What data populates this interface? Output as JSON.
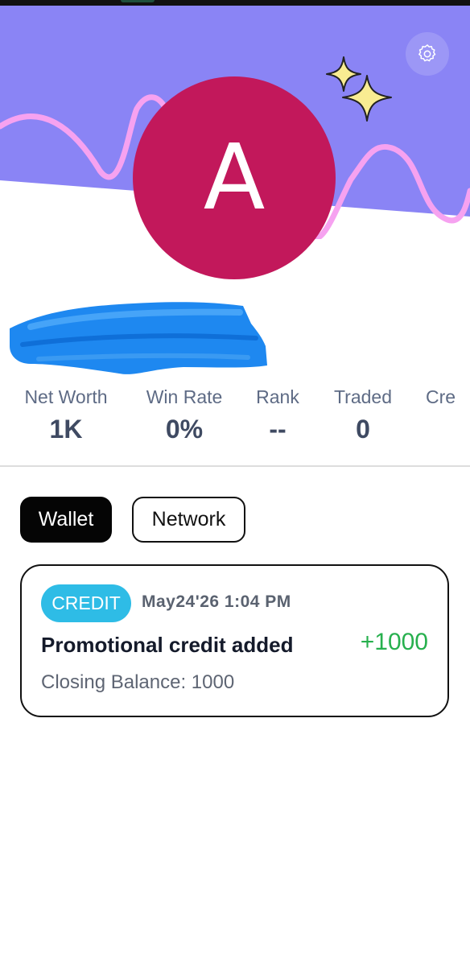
{
  "profile": {
    "avatar_letter": "A",
    "colors": {
      "header_bg": "#8a84f5",
      "wave": "#f6a2f0",
      "avatar_bg": "#c2185b",
      "sparkle": "#f9ec92"
    }
  },
  "stats": [
    {
      "label": "Net Worth",
      "value": "1K"
    },
    {
      "label": "Win Rate",
      "value": "0%"
    },
    {
      "label": "Rank",
      "value": "--"
    },
    {
      "label": "Traded",
      "value": "0"
    },
    {
      "label": "Cre",
      "value": ""
    }
  ],
  "tabs": {
    "wallet": "Wallet",
    "network": "Network",
    "active": "Wallet"
  },
  "transactions": [
    {
      "badge": "CREDIT",
      "date": "May24'26 1:04 PM",
      "title": "Promotional credit added",
      "amount": "+1000",
      "closing_balance": "Closing Balance: 1000",
      "colors": {
        "badge": "#2ebce6",
        "amount": "#27b04e"
      }
    }
  ],
  "icons": {
    "settings": "gear-icon",
    "decoration": "sparkle-icon"
  }
}
